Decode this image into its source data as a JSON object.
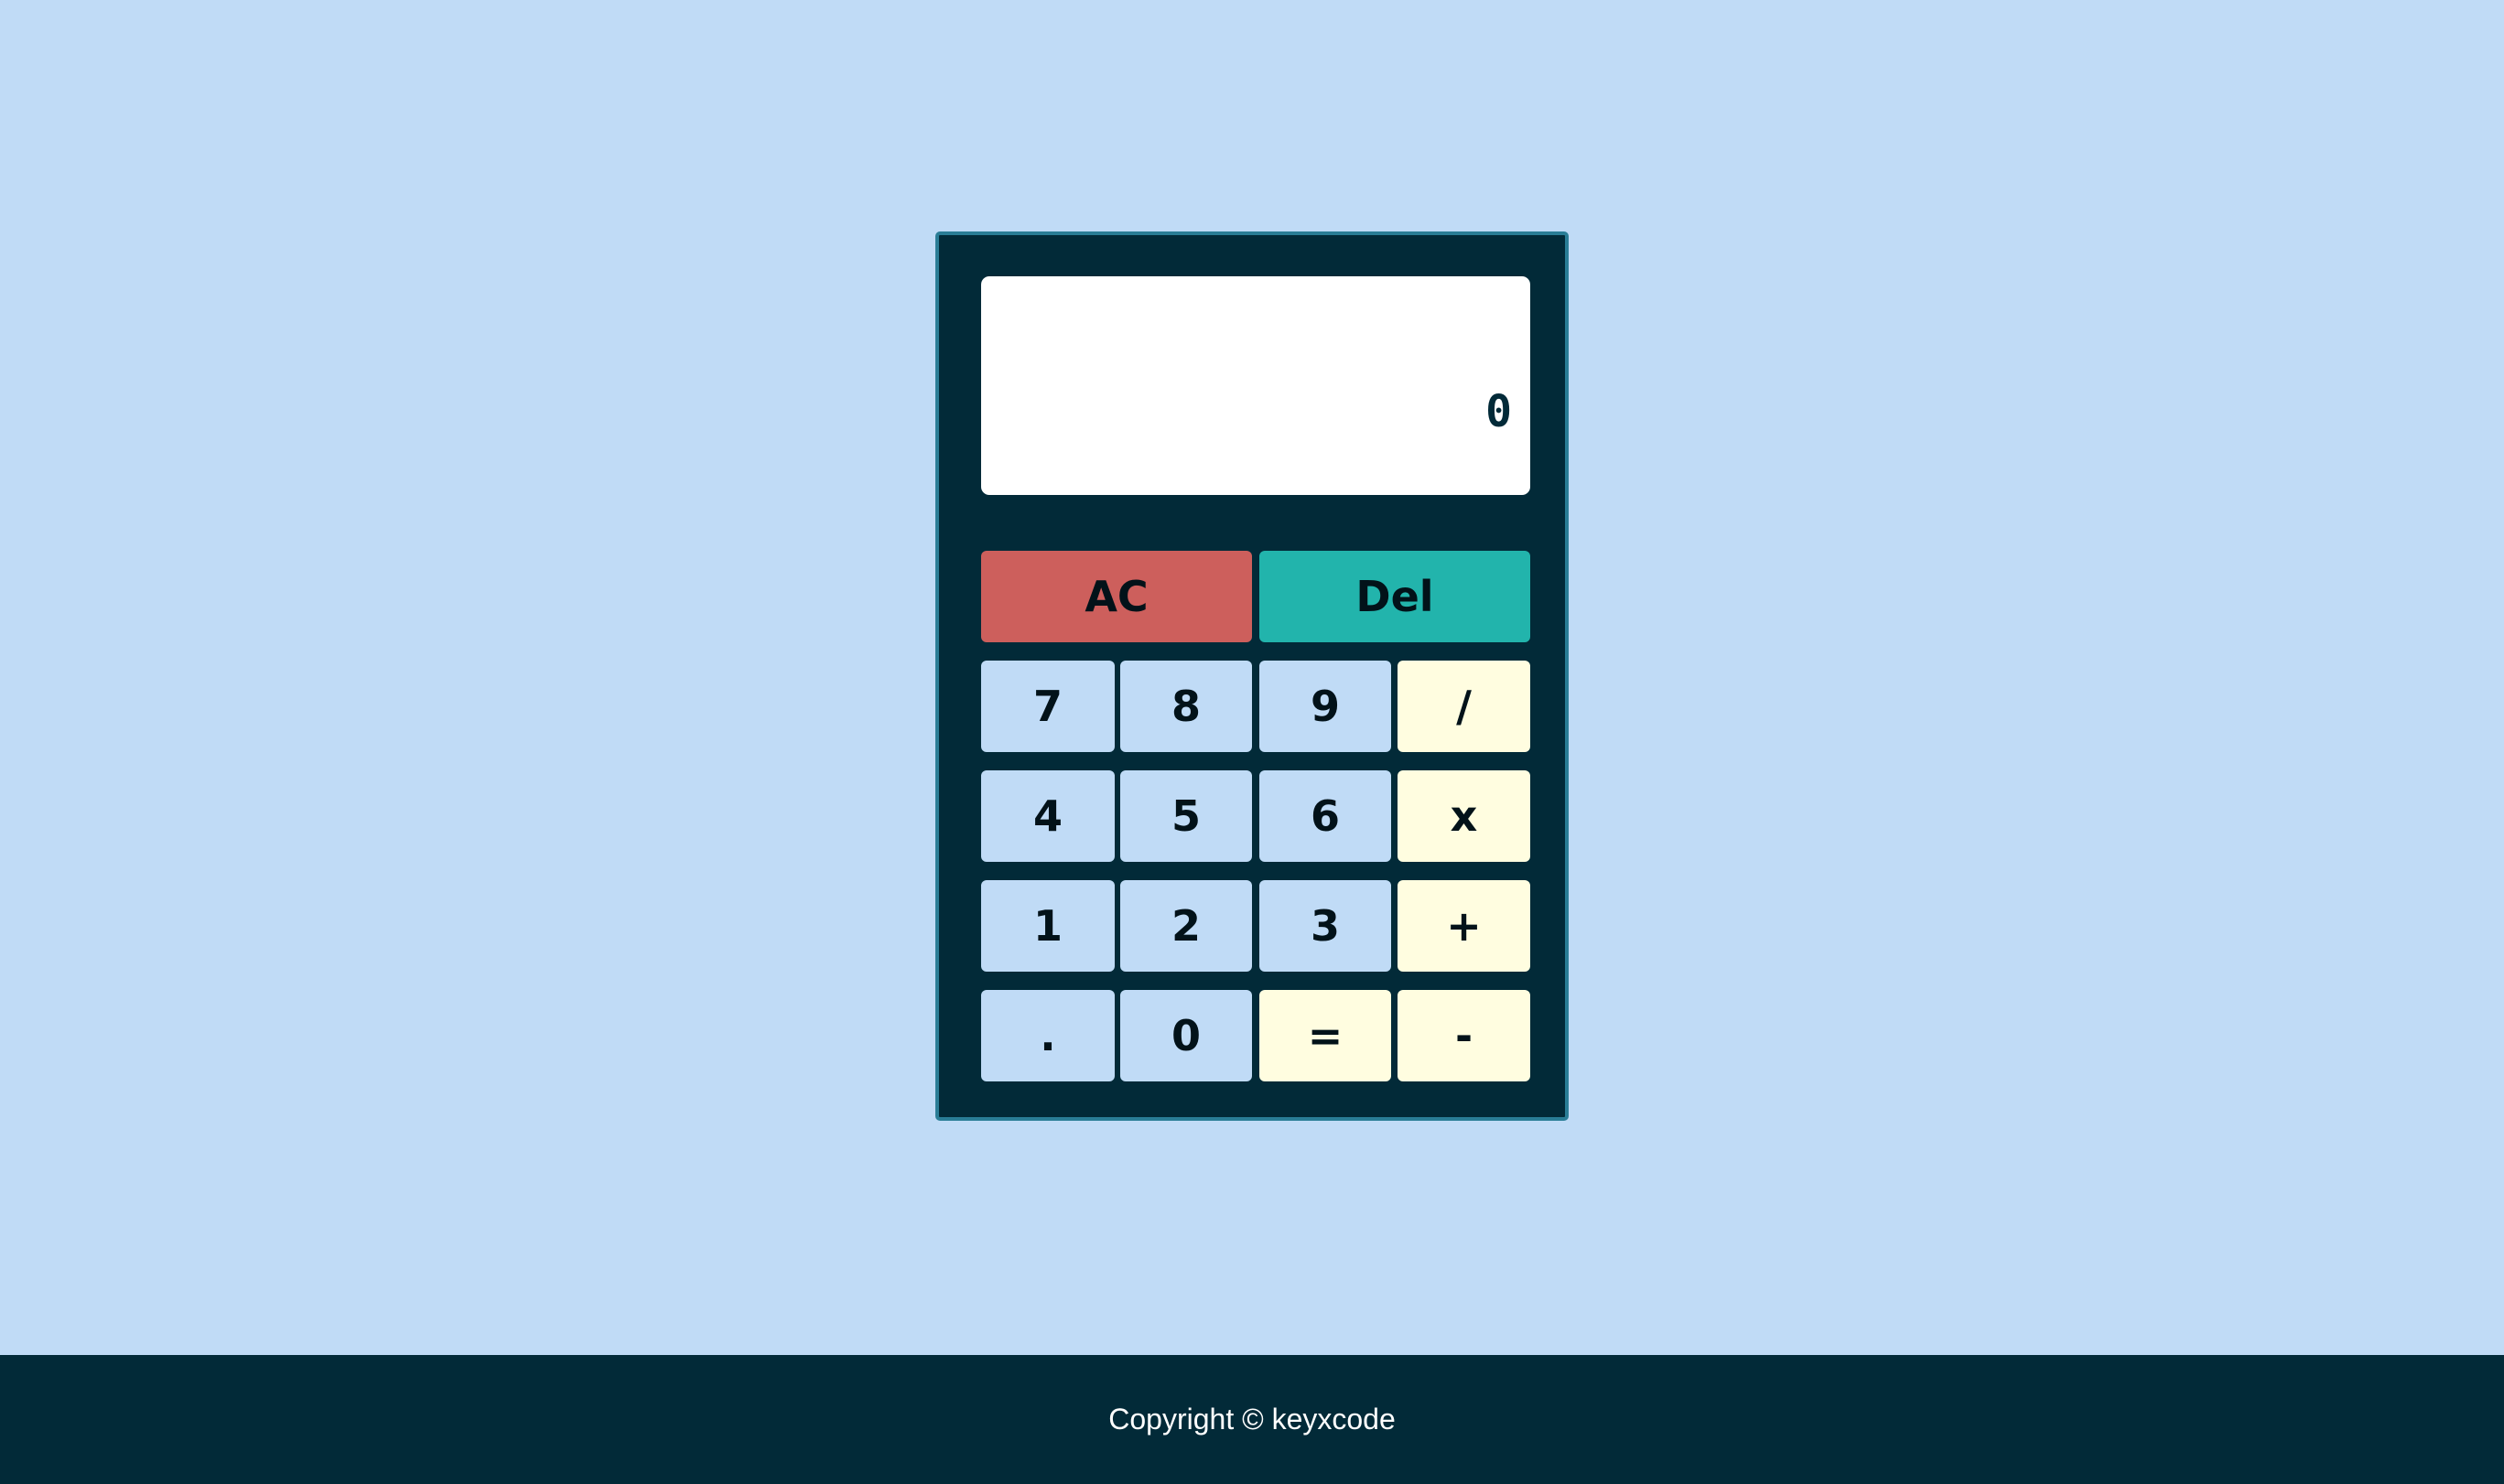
{
  "colors": {
    "background": "#c0dbf6",
    "calculator_body": "#022a38",
    "calculator_border": "#2a7d96",
    "display": "#ffffff",
    "number_key": "#c0dbf6",
    "operator_key": "#fffde0",
    "clear_key": "#cd5f5c",
    "delete_key": "#22b4ac",
    "footer": "#022a38"
  },
  "display": {
    "value": "0"
  },
  "keys": {
    "ac": "AC",
    "del": "Del",
    "seven": "7",
    "eight": "8",
    "nine": "9",
    "divide": "/",
    "four": "4",
    "five": "5",
    "six": "6",
    "multiply": "x",
    "one": "1",
    "two": "2",
    "three": "3",
    "plus": "+",
    "dot": ".",
    "zero": "0",
    "equals": "=",
    "minus": "-"
  },
  "footer": {
    "copyright": "Copyright © keyxcode"
  }
}
